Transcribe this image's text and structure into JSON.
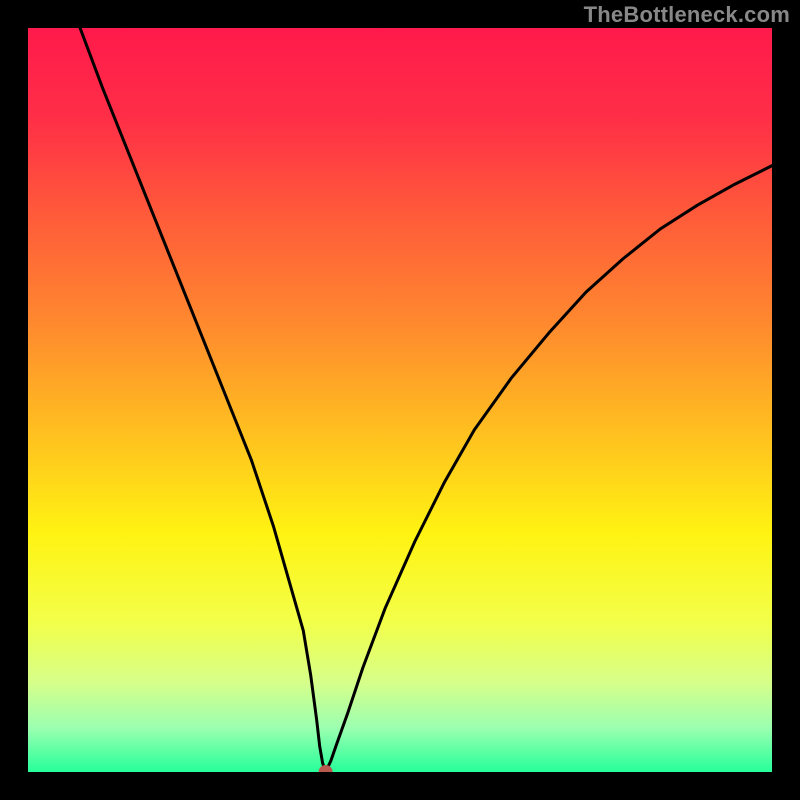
{
  "watermark": "TheBottleneck.com",
  "chart_data": {
    "type": "line",
    "title": "",
    "xlabel": "",
    "ylabel": "",
    "xlim": [
      0,
      100
    ],
    "ylim": [
      0,
      100
    ],
    "grid": false,
    "legend": false,
    "gradient_stops": [
      {
        "offset": 0.0,
        "color": "#ff1a4b"
      },
      {
        "offset": 0.12,
        "color": "#ff2e47"
      },
      {
        "offset": 0.25,
        "color": "#ff5a3a"
      },
      {
        "offset": 0.4,
        "color": "#ff8a2e"
      },
      {
        "offset": 0.55,
        "color": "#ffc21f"
      },
      {
        "offset": 0.68,
        "color": "#fff312"
      },
      {
        "offset": 0.8,
        "color": "#f2ff4a"
      },
      {
        "offset": 0.88,
        "color": "#d6ff8a"
      },
      {
        "offset": 0.94,
        "color": "#9cffb0"
      },
      {
        "offset": 1.0,
        "color": "#26ff9a"
      }
    ],
    "series": [
      {
        "name": "bottleneck-curve",
        "color": "#000000",
        "x": [
          7,
          10,
          14,
          18,
          22,
          26,
          30,
          33,
          35,
          37,
          38,
          38.8,
          39.2,
          39.6,
          40,
          40.7,
          41.5,
          43,
          45,
          48,
          52,
          56,
          60,
          65,
          70,
          75,
          80,
          85,
          90,
          95,
          100
        ],
        "y": [
          100,
          92,
          82,
          72,
          62,
          52,
          42,
          33,
          26,
          19,
          13,
          7,
          3.5,
          1.2,
          0,
          1.5,
          3.8,
          8,
          14,
          22,
          31,
          39,
          46,
          53,
          59,
          64.5,
          69,
          73,
          76.2,
          79,
          81.5
        ]
      }
    ],
    "marker": {
      "x": 40,
      "y": 0,
      "color": "#b85a50",
      "radius_px": 7
    }
  }
}
